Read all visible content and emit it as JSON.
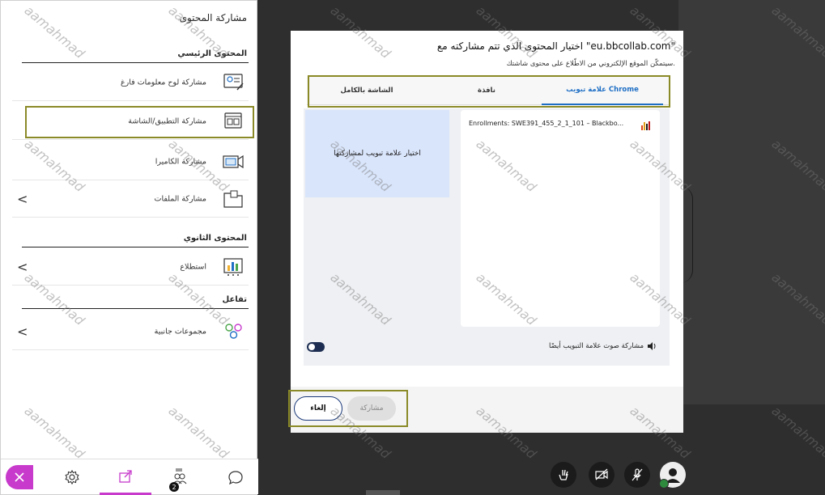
{
  "sidebar": {
    "title": "مشاركة المحتوى",
    "primary_section": "المحتوى الرئيسي",
    "secondary_section": "المحتوى الثانوي",
    "interaction_section": "تفاعل",
    "items": [
      {
        "label": "مشاركة لوح معلومات فارغ",
        "icon": "whiteboard-icon"
      },
      {
        "label": "مشاركة التطبيق/الشاشة",
        "icon": "screen-share-icon"
      },
      {
        "label": "مشاركة الكاميرا",
        "icon": "camera-icon"
      },
      {
        "label": "مشاركة الملفات",
        "icon": "folder-icon",
        "chevron": "<"
      }
    ],
    "secondary_items": [
      {
        "label": "استطلاع",
        "icon": "poll-icon",
        "chevron": "<"
      }
    ],
    "interaction_items": [
      {
        "label": "مجموعات جانبية",
        "icon": "breakout-groups-icon",
        "chevron": "<"
      }
    ],
    "bottom_bar": {
      "participants_badge": "2"
    }
  },
  "dialog": {
    "title": "اختيار المحتوى الذي تتم مشاركته مع \"eu.bbcollab.com\"",
    "subtitle": "سيتمكّن الموقع الإلكتروني من الاطّلاع على محتوى شاشتك.",
    "tabs": [
      {
        "label": "علامة تبويب Chrome",
        "active": true
      },
      {
        "label": "نافذة",
        "active": false
      },
      {
        "label": "الشاشة بالكامل",
        "active": false
      }
    ],
    "pick_prompt": "اختيار علامة تبويب لمشاركتها",
    "tab_entry": "Enrollments: SWE391_455_2_1_101 – Blackbo...",
    "audio_label": "مشاركة صوت علامة التبويب أيضًا",
    "cancel_label": "إلغاء",
    "share_label": "مشاركة"
  },
  "colors": {
    "accent": "#1f6fc5",
    "highlight": "#8b8a28",
    "pink": "#c73acb",
    "dark_bg": "#2e2e2e"
  },
  "watermark": "aamahmad"
}
